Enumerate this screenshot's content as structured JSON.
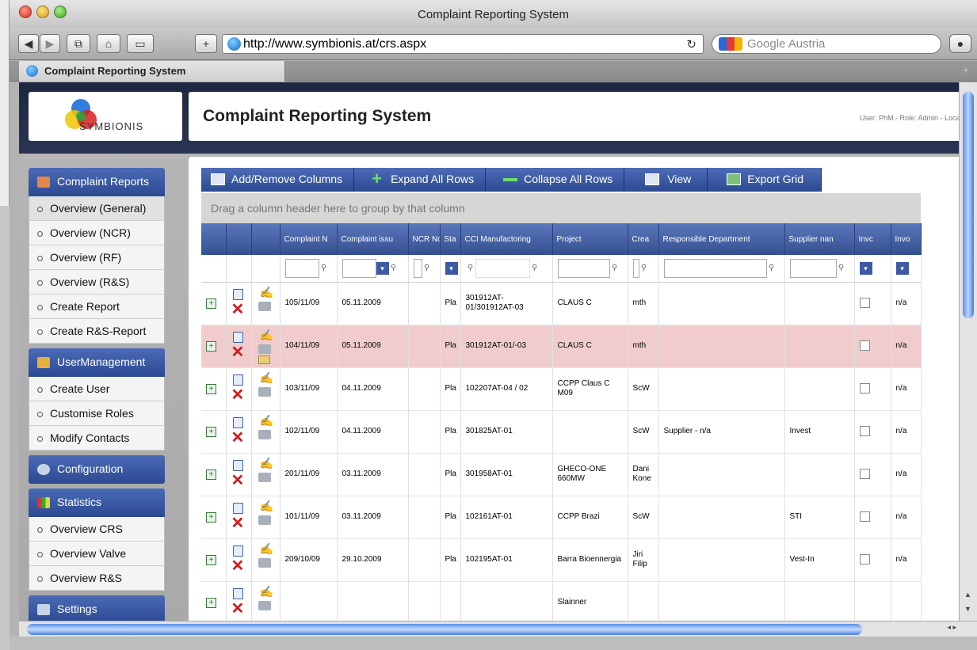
{
  "window": {
    "title": "Complaint Reporting System"
  },
  "toolbar": {
    "url": "http://www.symbionis.at/crs.aspx",
    "search_placeholder": "Google Austria"
  },
  "tab": {
    "label": "Complaint Reporting System"
  },
  "logo": {
    "text": "SYMBIONIS"
  },
  "header": {
    "title": "Complaint Reporting System",
    "user_info": "User: PhM - Role: Admin - Locat"
  },
  "sidebar": {
    "groups": [
      {
        "label": "Complaint Reports",
        "items": [
          "Overview (General)",
          "Overview (NCR)",
          "Overview (RF)",
          "Overview (R&S)",
          "Create Report",
          "Create R&S-Report"
        ]
      },
      {
        "label": "UserManagement",
        "items": [
          "Create User",
          "Customise Roles",
          "Modify Contacts"
        ]
      },
      {
        "label": "Configuration",
        "items": []
      },
      {
        "label": "Statistics",
        "items": [
          "Overview CRS",
          "Overview Valve",
          "Overview R&S"
        ]
      },
      {
        "label": "Settings",
        "items": []
      }
    ]
  },
  "grid_toolbar": {
    "add_remove": "Add/Remove Columns",
    "expand": "Expand All Rows",
    "collapse": "Collapse All Rows",
    "view": "View",
    "export": "Export Grid"
  },
  "group_hint": "Drag a column header here to group by that column",
  "columns": [
    "Complaint N",
    "Complaint issu",
    "NCR No",
    "Sta",
    "CCI Manufactoring",
    "Project",
    "Crea",
    "Responsible Department",
    "Supplier nan",
    "Invc",
    "Invo"
  ],
  "rows": [
    {
      "complaint_no": "105/11/09",
      "issued": "05.11.2009",
      "ncr": "",
      "status": "Pla",
      "cci": "301912AT-01/301912AT-03",
      "project": "CLAUS C",
      "creator": "mth",
      "department": "",
      "supplier": "",
      "inv": "n/a",
      "highlight": false,
      "mail": false
    },
    {
      "complaint_no": "104/11/09",
      "issued": "05.11.2009",
      "ncr": "",
      "status": "Pla",
      "cci": "301912AT-01/-03",
      "project": "CLAUS C",
      "creator": "mth",
      "department": "",
      "supplier": "",
      "inv": "n/a",
      "highlight": true,
      "mail": true
    },
    {
      "complaint_no": "103/11/09",
      "issued": "04.11.2009",
      "ncr": "",
      "status": "Pla",
      "cci": "102207AT-04 / 02",
      "project": "CCPP Claus C M09",
      "creator": "ScW",
      "department": "",
      "supplier": "",
      "inv": "n/a",
      "highlight": false,
      "mail": false
    },
    {
      "complaint_no": "102/11/09",
      "issued": "04.11.2009",
      "ncr": "",
      "status": "Pla",
      "cci": "301825AT-01",
      "project": "",
      "creator": "ScW",
      "department": "Supplier - n/a",
      "supplier": "Invest",
      "inv": "n/a",
      "highlight": false,
      "mail": false
    },
    {
      "complaint_no": "201/11/09",
      "issued": "03.11.2009",
      "ncr": "",
      "status": "Pla",
      "cci": "301958AT-01",
      "project": "GHECO-ONE 660MW",
      "creator": "Dani Kone",
      "department": "",
      "supplier": "",
      "inv": "n/a",
      "highlight": false,
      "mail": false
    },
    {
      "complaint_no": "101/11/09",
      "issued": "03.11.2009",
      "ncr": "",
      "status": "Pla",
      "cci": "102161AT-01",
      "project": "CCPP Brazi",
      "creator": "ScW",
      "department": "",
      "supplier": "STI",
      "inv": "n/a",
      "highlight": false,
      "mail": false
    },
    {
      "complaint_no": "209/10/09",
      "issued": "29.10.2009",
      "ncr": "",
      "status": "Pla",
      "cci": "102195AT-01",
      "project": "Barra Bioennergia",
      "creator": "Jiri Filip",
      "department": "",
      "supplier": "Vest-In",
      "inv": "n/a",
      "highlight": false,
      "mail": false
    },
    {
      "complaint_no": "",
      "issued": "",
      "ncr": "",
      "status": "",
      "cci": "",
      "project": "Slainner",
      "creator": "",
      "department": "",
      "supplier": "",
      "inv": "",
      "highlight": false,
      "mail": false
    }
  ]
}
